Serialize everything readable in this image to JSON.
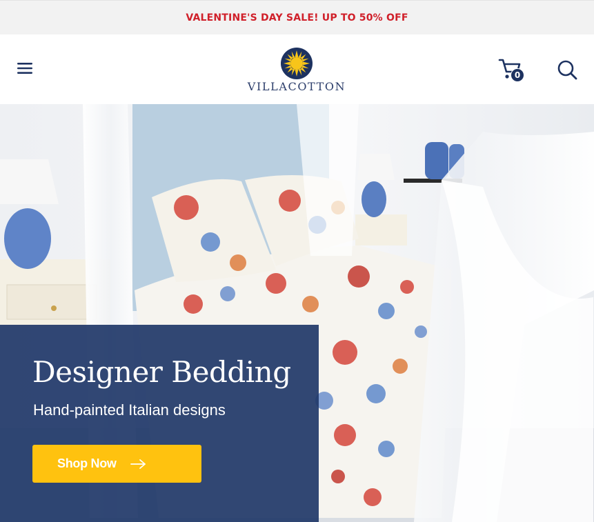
{
  "announcement": {
    "text": "VALENTINE'S DAY SALE! UP TO 50% OFF"
  },
  "header": {
    "logo_text": "VILLACOTTON",
    "cart_count": "0",
    "icons": {
      "menu": "hamburger-menu-icon",
      "cart": "cart-icon",
      "search": "search-icon",
      "logo": "sun-logo-icon"
    }
  },
  "hero": {
    "title": "Designer Bedding",
    "subtitle": "Hand-painted Italian designs",
    "cta_label": "Shop Now",
    "cta_icon": "arrow-right-icon"
  },
  "colors": {
    "announcement_text": "#d0202a",
    "brand_navy": "#1d3260",
    "promo_panel": "#203768",
    "cta_yellow": "#ffc20f",
    "logo_sun": "#f7c51a"
  }
}
